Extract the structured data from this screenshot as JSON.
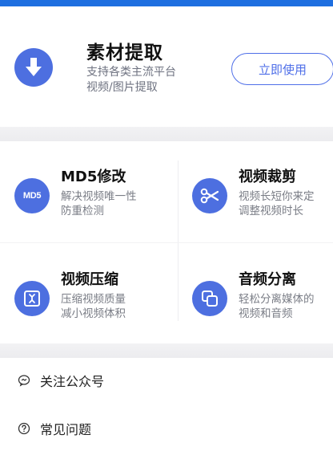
{
  "hero": {
    "title": "素材提取",
    "subtitle_line1": "支持各类主流平台",
    "subtitle_line2": "视频/图片提取",
    "button_label": "立即使用",
    "icon": "download-arrow-icon"
  },
  "tools": [
    {
      "icon": "md5-icon",
      "icon_text": "MD5",
      "title": "MD5修改",
      "desc_line1": "解决视频唯一性",
      "desc_line2": "防重检测"
    },
    {
      "icon": "scissors-icon",
      "title": "视频裁剪",
      "desc_line1": "视频长短你来定",
      "desc_line2": "调整视频时长"
    },
    {
      "icon": "compress-icon",
      "title": "视频压缩",
      "desc_line1": "压缩视频质量",
      "desc_line2": "减小视频体积"
    },
    {
      "icon": "separate-icon",
      "title": "音频分离",
      "desc_line1": "轻松分离媒体的",
      "desc_line2": "视频和音频"
    }
  ],
  "menu": [
    {
      "icon": "wechat-icon",
      "label": "关注公众号"
    },
    {
      "icon": "help-circle-icon",
      "label": "常见问题"
    }
  ],
  "colors": {
    "accent": "#4d6fe0",
    "topbar": "#1e6fe0",
    "separator": "#f0f0f2"
  }
}
